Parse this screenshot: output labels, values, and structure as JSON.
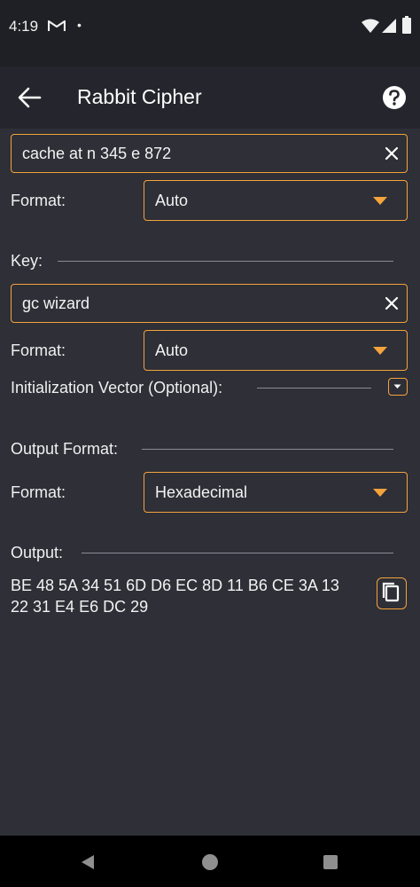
{
  "status": {
    "time": "4:19",
    "dot": "•"
  },
  "appbar": {
    "title": "Rabbit Cipher"
  },
  "input": {
    "value": "cache at n 345 e 872",
    "format_label": "Format:",
    "format_value": "Auto"
  },
  "key": {
    "section_label": "Key:",
    "value": "gc wizard",
    "format_label": "Format:",
    "format_value": "Auto"
  },
  "iv": {
    "label": "Initialization Vector (Optional):"
  },
  "output_format": {
    "section_label": "Output Format:",
    "format_label": "Format:",
    "format_value": "Hexadecimal"
  },
  "output": {
    "section_label": "Output:",
    "value": "BE 48 5A 34 51 6D D6 EC 8D 11 B6 CE 3A 13 22 31 E4 E6 DC 29"
  },
  "colors": {
    "accent": "#f5a33c",
    "background": "#2e2f37",
    "appbar": "#25262d",
    "statusbar": "#1f2026"
  }
}
